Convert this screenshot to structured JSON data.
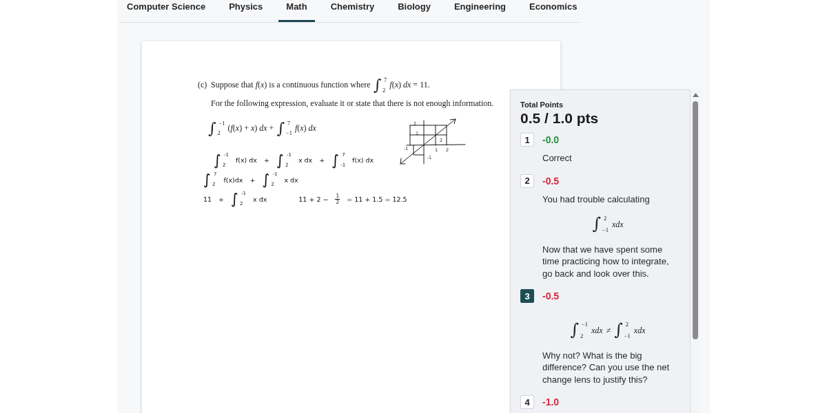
{
  "tabs": [
    {
      "label": "Computer Science",
      "selected": false
    },
    {
      "label": "Physics",
      "selected": false
    },
    {
      "label": "Math",
      "selected": true
    },
    {
      "label": "Chemistry",
      "selected": false
    },
    {
      "label": "Biology",
      "selected": false
    },
    {
      "label": "Engineering",
      "selected": false
    },
    {
      "label": "Economics",
      "selected": false
    }
  ],
  "document": {
    "problem_label": "(c)",
    "problem_lines": [
      [
        {
          "kind": "text",
          "text": "Suppose that *f*(*x*) is a continuous function where"
        },
        {
          "kind": "integral",
          "sign": "∫",
          "lower": "2",
          "upper": "7"
        },
        {
          "kind": "text",
          "text": "*f*(*x*) *dx* = 11."
        }
      ],
      [
        {
          "kind": "text",
          "text": "For the following expression, evaluate it or state that there is not enough information."
        }
      ],
      [
        {
          "kind": "integral",
          "sign": "∫",
          "lower": "2",
          "upper": "−1"
        },
        {
          "kind": "text",
          "text": "(*f*(*x*) + *x*) *dx* +"
        },
        {
          "kind": "integral",
          "sign": "∫",
          "lower": "−1",
          "upper": "7"
        },
        {
          "kind": "text",
          "text": "*f*(*x*) *dx*"
        }
      ]
    ],
    "work_lines": [
      {
        "segments": [
          [
            {
              "kind": "integral",
              "sign": "∫",
              "lower": "2",
              "upper": "-1"
            },
            {
              "kind": "text",
              "text": "f(x) dx"
            },
            {
              "kind": "text",
              "text": "+"
            },
            {
              "kind": "integral",
              "sign": "∫",
              "lower": "2",
              "upper": "-1"
            },
            {
              "kind": "text",
              "text": "x dx"
            },
            {
              "kind": "text",
              "text": "+"
            },
            {
              "kind": "integral",
              "sign": "∫",
              "lower": "-1",
              "upper": "7"
            },
            {
              "kind": "text",
              "text": "f(x) dx"
            }
          ]
        ]
      },
      {
        "segments": [
          [
            {
              "kind": "integral",
              "sign": "∫",
              "lower": "2",
              "upper": "7"
            },
            {
              "kind": "text",
              "text": "f(x)dx"
            },
            {
              "kind": "text",
              "text": "+"
            },
            {
              "kind": "integral",
              "sign": "∫",
              "lower": "2",
              "upper": "-1"
            },
            {
              "kind": "text",
              "text": "x dx"
            }
          ]
        ]
      },
      {
        "segments": [
          [
            {
              "kind": "text",
              "text": "11"
            },
            {
              "kind": "text",
              "text": "+"
            },
            {
              "kind": "integral",
              "sign": "∫",
              "lower": "2",
              "upper": "-1"
            },
            {
              "kind": "text",
              "text": "x dx"
            }
          ],
          [
            {
              "kind": "text",
              "text": "11 + 2 −"
            },
            {
              "kind": "frac",
              "num": "1",
              "den": "2"
            },
            {
              "kind": "text",
              "text": "= 11 + 1.5 = 12.5"
            }
          ]
        ]
      }
    ],
    "sketch": {
      "labels": [
        "2",
        "1",
        "2",
        "-1",
        "1",
        "2",
        "-1"
      ]
    }
  },
  "grading": {
    "title": "Total Points",
    "score": "0.5 / 1.0 pts",
    "items": [
      {
        "number": "1",
        "points": "-0.0",
        "color": "#23923a",
        "selected": false,
        "comment": [
          {
            "kind": "text",
            "text": "Correct"
          }
        ]
      },
      {
        "number": "2",
        "points": "-0.5",
        "color": "#d7263d",
        "selected": false,
        "comment": [
          {
            "kind": "text",
            "text": "You had trouble calculating"
          },
          {
            "kind": "math",
            "parts": [
              {
                "kind": "integral",
                "sign": "∫",
                "lower": "−1",
                "upper": "2"
              },
              {
                "kind": "var",
                "text": "xdx"
              }
            ]
          },
          {
            "kind": "text",
            "text": "Now that we have spent some time practicing how to integrate, go back and look over this."
          }
        ]
      },
      {
        "number": "3",
        "points": "-0.5",
        "color": "#d7263d",
        "selected": true,
        "comment": [
          {
            "kind": "math",
            "parts": [
              {
                "kind": "integral",
                "sign": "∫",
                "lower": "2",
                "upper": "−1"
              },
              {
                "kind": "var",
                "text": "xdx"
              },
              {
                "kind": "text",
                "text": "≠"
              },
              {
                "kind": "integral",
                "sign": "∫",
                "lower": "−1",
                "upper": "2"
              },
              {
                "kind": "var",
                "text": "xdx"
              }
            ]
          },
          {
            "kind": "text",
            "text": "Why not? What is the big difference? Can you use the net change lens to justify this?"
          }
        ]
      },
      {
        "number": "4",
        "points": "-1.0",
        "color": "#d7263d",
        "selected": false
      }
    ]
  }
}
